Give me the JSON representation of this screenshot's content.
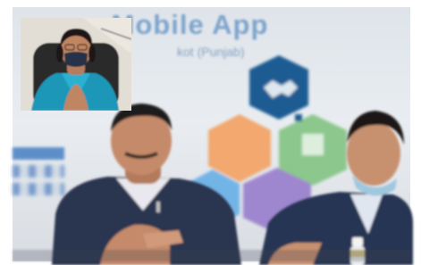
{
  "banner": {
    "title": "n Mobile App",
    "subtitle": "kot (Punjab)",
    "small_text": ""
  },
  "colors": {
    "banner_blue": "#5c8fc2",
    "hex_navy": "#1f5c93",
    "hex_orange": "#f2a86e",
    "hex_green": "#8cc78d",
    "hex_sky": "#73b4e6",
    "hex_purple": "#9f87cf",
    "suit": "#2a3550",
    "inset_saree": "#1f97b8"
  }
}
